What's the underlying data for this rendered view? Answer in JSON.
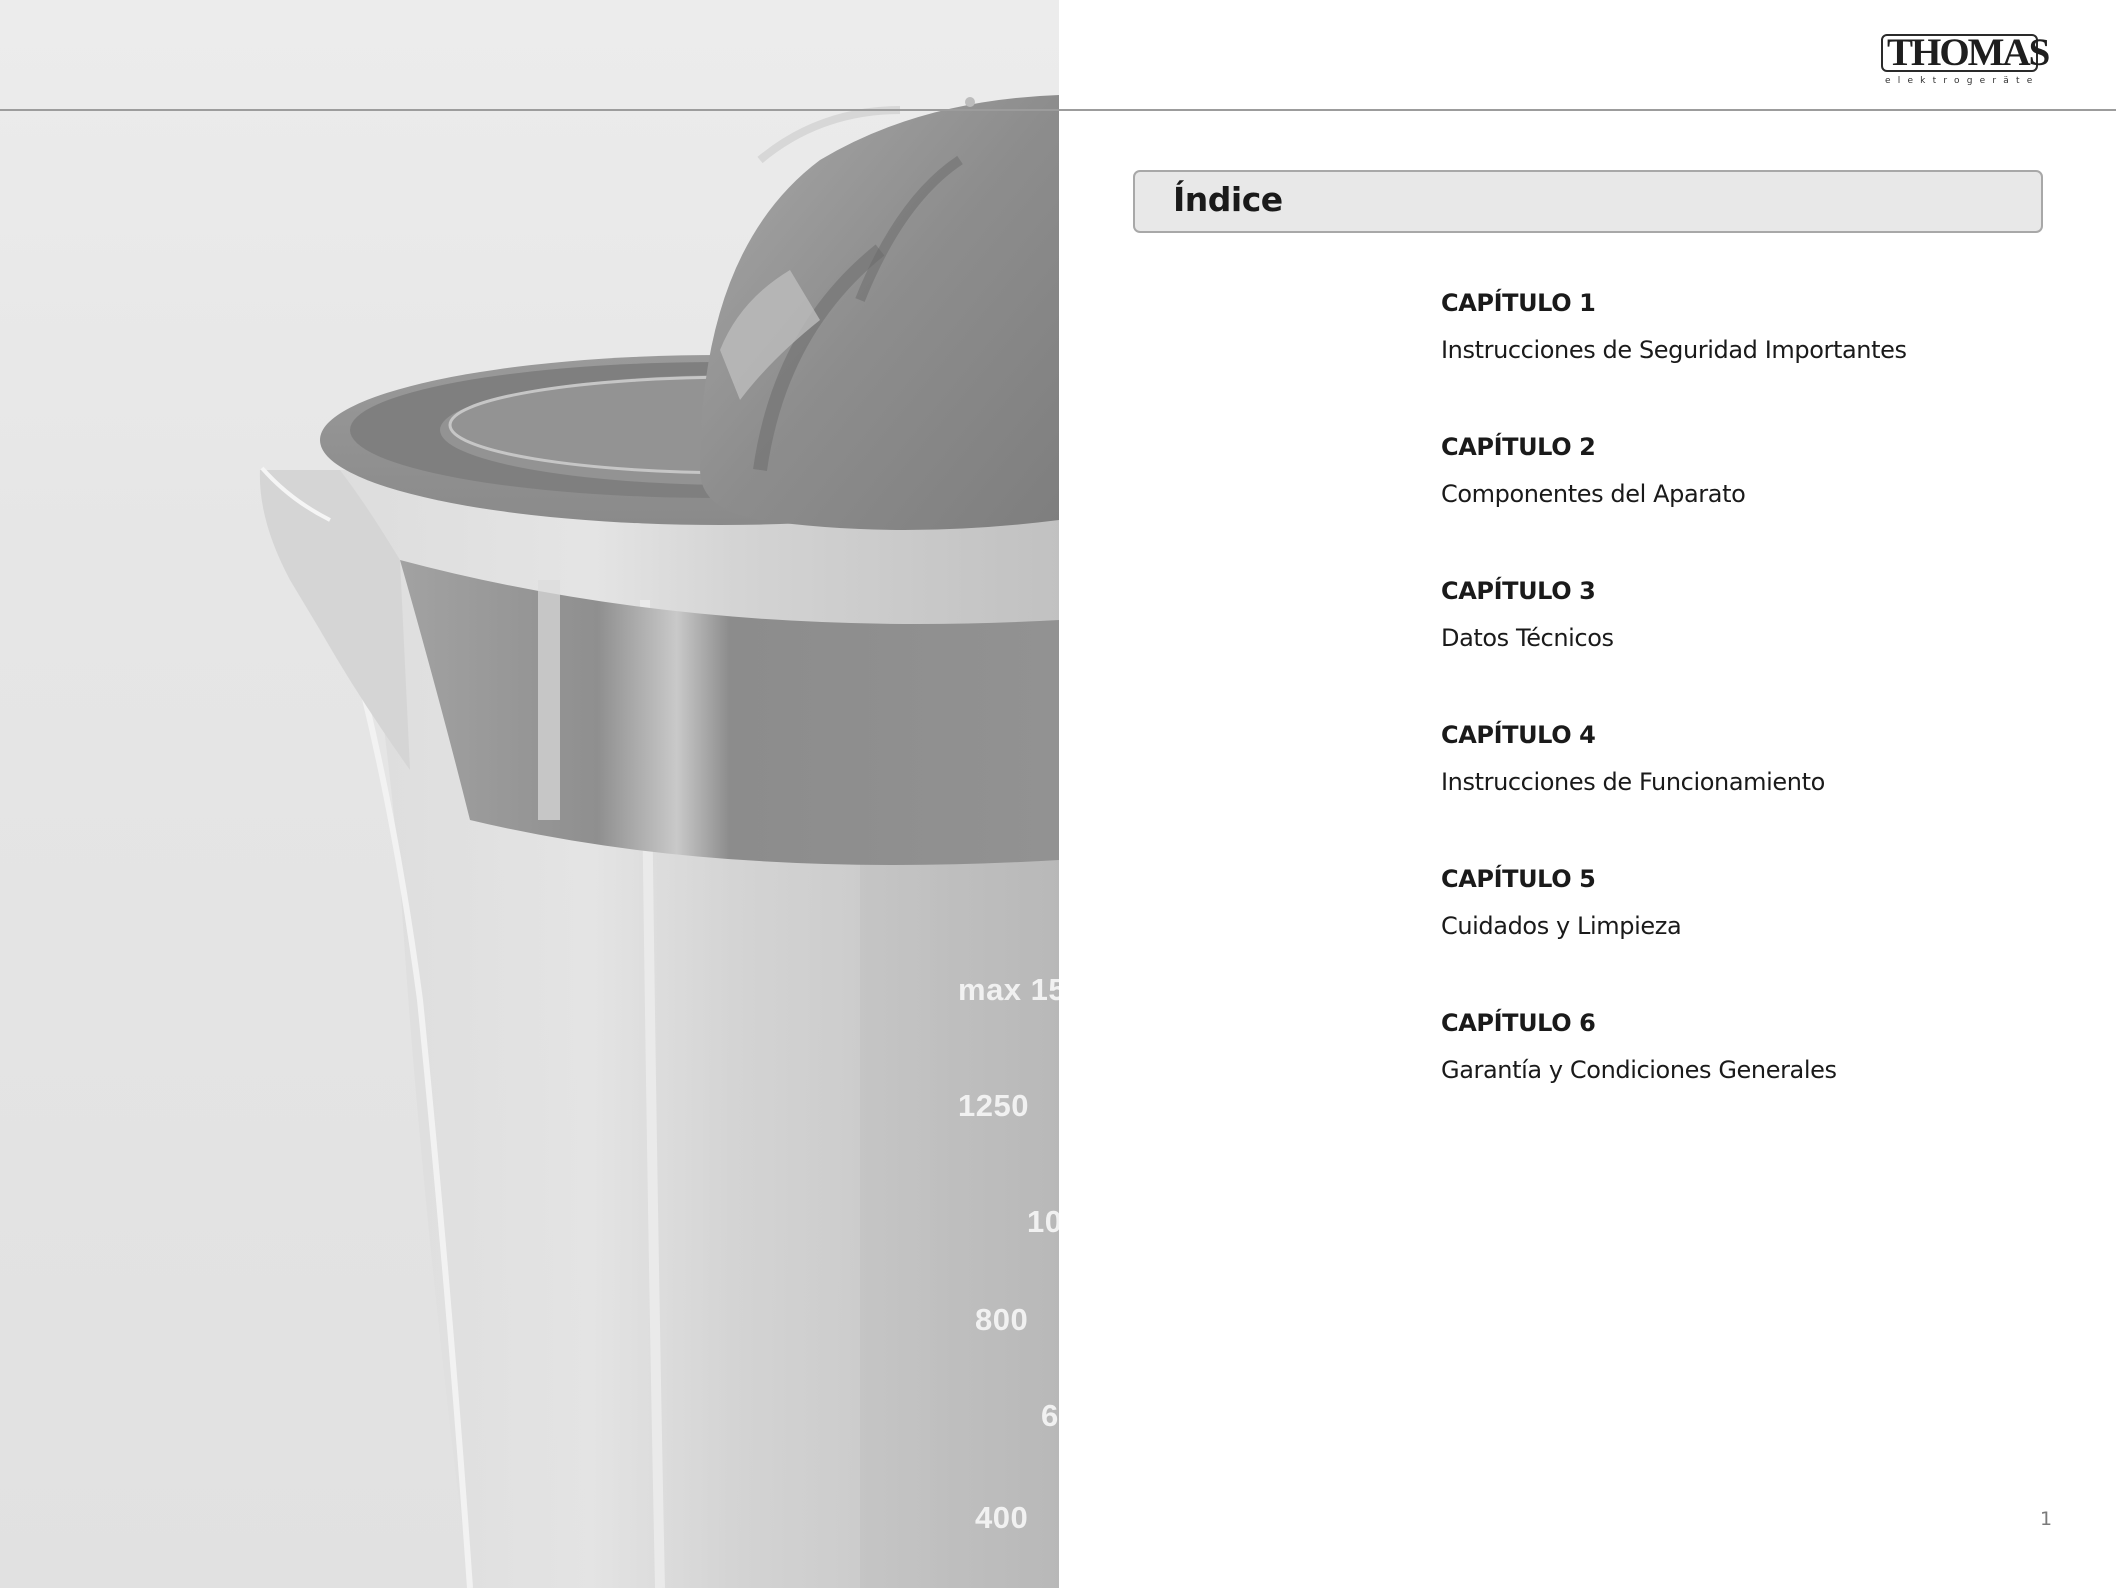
{
  "brand": {
    "name": "THOMAS",
    "tagline": "elektrogeräte"
  },
  "index": {
    "title": "Índice"
  },
  "chapters": [
    {
      "label": "CAPÍTULO 1",
      "title": "Instrucciones de Seguridad Importantes"
    },
    {
      "label": "CAPÍTULO 2",
      "title": "Componentes del Aparato"
    },
    {
      "label": "CAPÍTULO 3",
      "title": "Datos Técnicos"
    },
    {
      "label": "CAPÍTULO 4",
      "title": "Instrucciones de Funcionamiento"
    },
    {
      "label": "CAPÍTULO 5",
      "title": "Cuidados y Limpieza"
    },
    {
      "label": "CAPÍTULO 6",
      "title": "Garantía y Condiciones Generales"
    }
  ],
  "photo": {
    "scale_marks": [
      "max 15",
      "1250",
      "10",
      "800",
      "6",
      "400"
    ]
  },
  "page_number": "1",
  "colors": {
    "rule": "#9c9c9c",
    "index_bar_fill": "#e8e8e8",
    "index_bar_border": "#a8a8a8",
    "photo_background": "#e6e6e6"
  }
}
